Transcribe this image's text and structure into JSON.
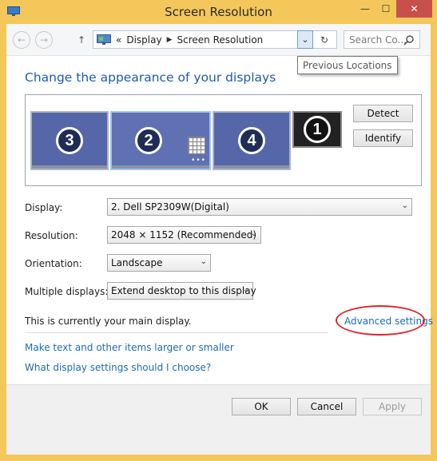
{
  "window": {
    "title": "Screen Resolution",
    "accent": "#f4c75b",
    "close_color": "#c7504a"
  },
  "titlebar": {
    "minimize_glyph": "—",
    "maximize_glyph": "☐",
    "close_glyph": "✕"
  },
  "address_bar": {
    "back_glyph": "←",
    "forward_glyph": "→",
    "up_glyph": "↑",
    "prefix": "«",
    "crumbs": [
      "Display",
      "Screen Resolution"
    ],
    "separator": "▶",
    "dropdown_glyph": "⌄",
    "refresh_glyph": "↻",
    "search_placeholder": "Search Co...",
    "search_glyph": "⚲"
  },
  "tooltip": "Previous Locations",
  "heading": "Change the appearance of your displays",
  "monitors": [
    {
      "number": "3",
      "selected": false
    },
    {
      "number": "2",
      "selected": true,
      "dots": "•••"
    },
    {
      "number": "4",
      "selected": false
    },
    {
      "number": "1",
      "selected": false
    }
  ],
  "buttons": {
    "detect": "Detect",
    "identify": "Identify",
    "ok": "OK",
    "cancel": "Cancel",
    "apply": "Apply"
  },
  "form": {
    "display_label": "Display:",
    "display_value": "2. Dell SP2309W(Digital)",
    "resolution_label": "Resolution:",
    "resolution_value": "2048 × 1152 (Recommended)",
    "orientation_label": "Orientation:",
    "orientation_value": "Landscape",
    "multiple_label": "Multiple displays:",
    "multiple_value": "Extend desktop to this display",
    "dropdown_arrow": "⌄"
  },
  "main_display_text": "This is currently your main display.",
  "links": {
    "advanced": "Advanced settings",
    "text_size": "Make text and other items larger or smaller",
    "help": "What display settings should I choose?"
  },
  "annotation_color": "#e0242a"
}
